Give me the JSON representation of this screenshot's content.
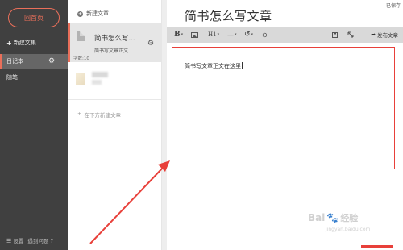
{
  "sidebar": {
    "home_button": "回首页",
    "new_notebook": "新建文集",
    "notebooks": [
      {
        "label": "日记本",
        "active": true
      },
      {
        "label": "随笔",
        "active": false
      }
    ],
    "footer": {
      "settings": "设置",
      "help": "遇到问题"
    }
  },
  "notes": {
    "new_article": "新建文章",
    "items": [
      {
        "title": "简书怎么写...",
        "snippet": "简书写文章正文...",
        "word_count": "字数:10"
      }
    ],
    "add_below": "在下方新建文章"
  },
  "editor": {
    "save_status": "已保存",
    "title": "简书怎么写文章",
    "toolbar": {
      "bold": "B",
      "heading": "H1",
      "hr": "—",
      "undo": "↺",
      "history": "⊙",
      "publish": "发布文章"
    },
    "content": "简书写文章正文在这里"
  },
  "watermark": {
    "brand": "Bai",
    "brand_cn": "经验",
    "url": "jingyan.baidu.com"
  },
  "colors": {
    "sidebar_bg": "#404040",
    "accent": "#ea6f5a",
    "annotation": "#e8403a",
    "toolbar_bg": "#d9d9d9"
  }
}
